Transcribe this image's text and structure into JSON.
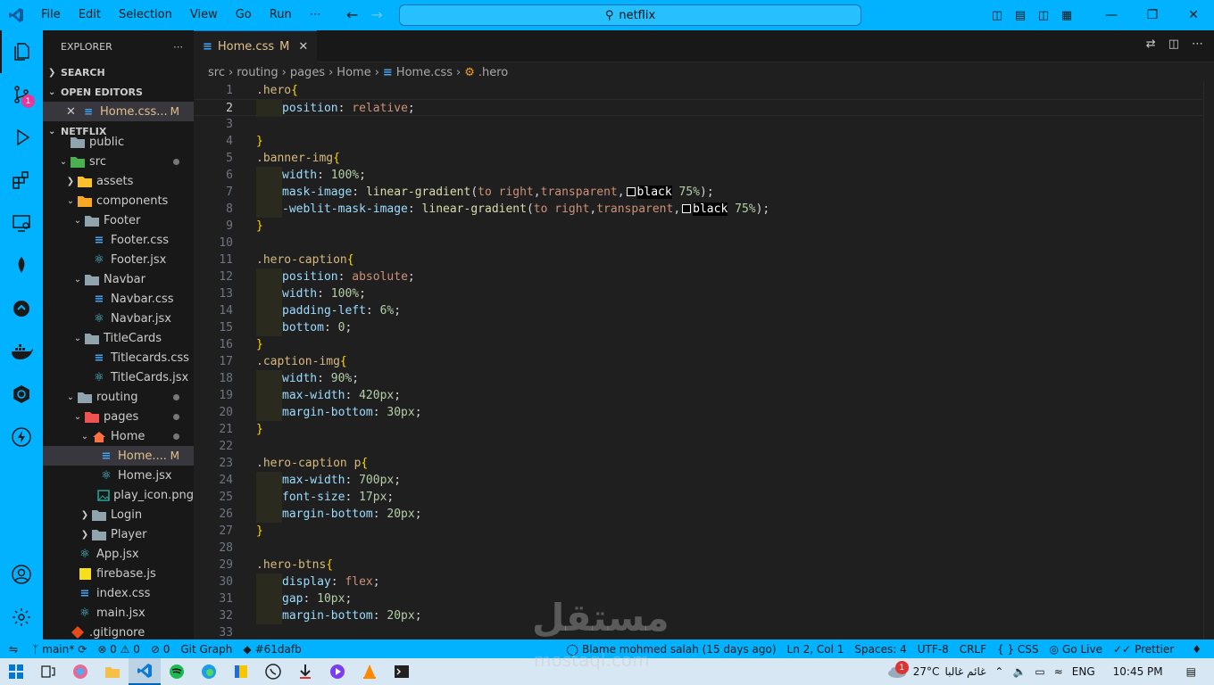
{
  "titlebar": {
    "menu": [
      "File",
      "Edit",
      "Selection",
      "View",
      "Go",
      "Run",
      "⋯"
    ],
    "search": "netflix"
  },
  "activity_badge": "1",
  "sidebar": {
    "title": "EXPLORER",
    "search": "SEARCH",
    "open_editors": "OPEN EDITORS",
    "open_file": "Home.css...",
    "open_file_mark": "M",
    "project": "NETFLIX",
    "tree": [
      {
        "label": "public",
        "depth": 1,
        "icon": "folder",
        "chev": "",
        "mark": ""
      },
      {
        "label": "src",
        "depth": 1,
        "icon": "folder-src",
        "chev": "v",
        "mark": "dot"
      },
      {
        "label": "assets",
        "depth": 2,
        "icon": "folder-assets",
        "chev": ">",
        "mark": ""
      },
      {
        "label": "components",
        "depth": 2,
        "icon": "folder-components",
        "chev": "v",
        "mark": ""
      },
      {
        "label": "Footer",
        "depth": 3,
        "icon": "folder",
        "chev": "v",
        "mark": ""
      },
      {
        "label": "Footer.css",
        "depth": 4,
        "icon": "css",
        "chev": "",
        "mark": ""
      },
      {
        "label": "Footer.jsx",
        "depth": 4,
        "icon": "react",
        "chev": "",
        "mark": ""
      },
      {
        "label": "Navbar",
        "depth": 3,
        "icon": "folder",
        "chev": "v",
        "mark": ""
      },
      {
        "label": "Navbar.css",
        "depth": 4,
        "icon": "css",
        "chev": "",
        "mark": ""
      },
      {
        "label": "Navbar.jsx",
        "depth": 4,
        "icon": "react",
        "chev": "",
        "mark": ""
      },
      {
        "label": "TitleCards",
        "depth": 3,
        "icon": "folder",
        "chev": "v",
        "mark": ""
      },
      {
        "label": "Titlecards.css",
        "depth": 4,
        "icon": "css",
        "chev": "",
        "mark": ""
      },
      {
        "label": "TitleCards.jsx",
        "depth": 4,
        "icon": "react",
        "chev": "",
        "mark": ""
      },
      {
        "label": "routing",
        "depth": 2,
        "icon": "folder",
        "chev": "v",
        "mark": "dot"
      },
      {
        "label": "pages",
        "depth": 3,
        "icon": "folder-pages",
        "chev": "v",
        "mark": "dot"
      },
      {
        "label": "Home",
        "depth": 4,
        "icon": "folder-home",
        "chev": "v",
        "mark": "dot"
      },
      {
        "label": "Home....",
        "depth": 5,
        "icon": "css",
        "chev": "",
        "mark": "M",
        "selected": true
      },
      {
        "label": "Home.jsx",
        "depth": 5,
        "icon": "react",
        "chev": "",
        "mark": ""
      },
      {
        "label": "play_icon.png",
        "depth": 5,
        "icon": "image",
        "chev": "",
        "mark": ""
      },
      {
        "label": "Login",
        "depth": 4,
        "icon": "folder",
        "chev": ">",
        "mark": ""
      },
      {
        "label": "Player",
        "depth": 4,
        "icon": "folder",
        "chev": ">",
        "mark": ""
      },
      {
        "label": "App.jsx",
        "depth": 2,
        "icon": "react",
        "chev": "",
        "mark": ""
      },
      {
        "label": "firebase.js",
        "depth": 2,
        "icon": "js",
        "chev": "",
        "mark": ""
      },
      {
        "label": "index.css",
        "depth": 2,
        "icon": "css",
        "chev": "",
        "mark": ""
      },
      {
        "label": "main.jsx",
        "depth": 2,
        "icon": "react",
        "chev": "",
        "mark": ""
      },
      {
        "label": ".gitignore",
        "depth": 1,
        "icon": "git",
        "chev": "",
        "mark": ""
      }
    ]
  },
  "tab": {
    "label": "Home.css",
    "mark": "M"
  },
  "breadcrumb": [
    "src",
    "routing",
    "pages",
    "Home",
    "Home.css",
    ".hero"
  ],
  "code": [
    [
      [
        "sel",
        ".hero"
      ],
      [
        "br",
        "{"
      ]
    ],
    [
      [
        "i",
        ""
      ],
      [
        "prop",
        "position"
      ],
      [
        "pun",
        ": "
      ],
      [
        "val",
        "relative"
      ],
      [
        "pun",
        ";"
      ]
    ],
    [],
    [
      [
        "br",
        "}"
      ]
    ],
    [
      [
        "sel",
        ".banner-img"
      ],
      [
        "br",
        "{"
      ]
    ],
    [
      [
        "i",
        ""
      ],
      [
        "prop",
        "width"
      ],
      [
        "pun",
        ": "
      ],
      [
        "num",
        "100%"
      ],
      [
        "pun",
        ";"
      ]
    ],
    [
      [
        "i",
        ""
      ],
      [
        "prop",
        "mask-image"
      ],
      [
        "pun",
        ": "
      ],
      [
        "fn",
        "linear-gradient"
      ],
      [
        "pun",
        "("
      ],
      [
        "val",
        "to"
      ],
      [
        "pun",
        " "
      ],
      [
        "val",
        "right"
      ],
      [
        "pun",
        ","
      ],
      [
        "val",
        "transparent"
      ],
      [
        "pun",
        ","
      ],
      [
        "sw",
        ""
      ],
      [
        "blk",
        "black"
      ],
      [
        "pun",
        " "
      ],
      [
        "num",
        "75%"
      ],
      [
        "pun",
        ");"
      ]
    ],
    [
      [
        "i",
        ""
      ],
      [
        "prop",
        "-weblit-mask-image"
      ],
      [
        "pun",
        ": "
      ],
      [
        "fn",
        "linear-gradient"
      ],
      [
        "pun",
        "("
      ],
      [
        "val",
        "to"
      ],
      [
        "pun",
        " "
      ],
      [
        "val",
        "right"
      ],
      [
        "pun",
        ","
      ],
      [
        "val",
        "transparent"
      ],
      [
        "pun",
        ","
      ],
      [
        "sw",
        ""
      ],
      [
        "blk",
        "black"
      ],
      [
        "pun",
        " "
      ],
      [
        "num",
        "75%"
      ],
      [
        "pun",
        ");"
      ]
    ],
    [
      [
        "br",
        "}"
      ]
    ],
    [],
    [
      [
        "sel",
        ".hero-caption"
      ],
      [
        "br",
        "{"
      ]
    ],
    [
      [
        "i",
        ""
      ],
      [
        "prop",
        "position"
      ],
      [
        "pun",
        ": "
      ],
      [
        "val",
        "absolute"
      ],
      [
        "pun",
        ";"
      ]
    ],
    [
      [
        "i",
        ""
      ],
      [
        "prop",
        "width"
      ],
      [
        "pun",
        ": "
      ],
      [
        "num",
        "100%"
      ],
      [
        "pun",
        ";"
      ]
    ],
    [
      [
        "i",
        ""
      ],
      [
        "prop",
        "padding-left"
      ],
      [
        "pun",
        ": "
      ],
      [
        "num",
        "6%"
      ],
      [
        "pun",
        ";"
      ]
    ],
    [
      [
        "i",
        ""
      ],
      [
        "prop",
        "bottom"
      ],
      [
        "pun",
        ": "
      ],
      [
        "num",
        "0"
      ],
      [
        "pun",
        ";"
      ]
    ],
    [
      [
        "br",
        "}"
      ]
    ],
    [
      [
        "sel",
        ".caption-img"
      ],
      [
        "br",
        "{"
      ]
    ],
    [
      [
        "i",
        ""
      ],
      [
        "prop",
        "width"
      ],
      [
        "pun",
        ": "
      ],
      [
        "num",
        "90%"
      ],
      [
        "pun",
        ";"
      ]
    ],
    [
      [
        "i",
        ""
      ],
      [
        "prop",
        "max-width"
      ],
      [
        "pun",
        ": "
      ],
      [
        "num",
        "420px"
      ],
      [
        "pun",
        ";"
      ]
    ],
    [
      [
        "i",
        ""
      ],
      [
        "prop",
        "margin-bottom"
      ],
      [
        "pun",
        ": "
      ],
      [
        "num",
        "30px"
      ],
      [
        "pun",
        ";"
      ]
    ],
    [
      [
        "br",
        "}"
      ]
    ],
    [],
    [
      [
        "sel",
        ".hero-caption p"
      ],
      [
        "br",
        "{"
      ]
    ],
    [
      [
        "i",
        ""
      ],
      [
        "prop",
        "max-width"
      ],
      [
        "pun",
        ": "
      ],
      [
        "num",
        "700px"
      ],
      [
        "pun",
        ";"
      ]
    ],
    [
      [
        "i",
        ""
      ],
      [
        "prop",
        "font-size"
      ],
      [
        "pun",
        ": "
      ],
      [
        "num",
        "17px"
      ],
      [
        "pun",
        ";"
      ]
    ],
    [
      [
        "i",
        ""
      ],
      [
        "prop",
        "margin-bottom"
      ],
      [
        "pun",
        ": "
      ],
      [
        "num",
        "20px"
      ],
      [
        "pun",
        ";"
      ]
    ],
    [
      [
        "br",
        "}"
      ]
    ],
    [],
    [
      [
        "sel",
        ".hero-btns"
      ],
      [
        "br",
        "{"
      ]
    ],
    [
      [
        "i",
        ""
      ],
      [
        "prop",
        "display"
      ],
      [
        "pun",
        ": "
      ],
      [
        "val",
        "flex"
      ],
      [
        "pun",
        ";"
      ]
    ],
    [
      [
        "i",
        ""
      ],
      [
        "prop",
        "gap"
      ],
      [
        "pun",
        ": "
      ],
      [
        "num",
        "10px"
      ],
      [
        "pun",
        ";"
      ]
    ],
    [
      [
        "i",
        ""
      ],
      [
        "prop",
        "margin-bottom"
      ],
      [
        "pun",
        ": "
      ],
      [
        "num",
        "20px"
      ],
      [
        "pun",
        ";"
      ]
    ],
    []
  ],
  "current_line": 2,
  "status": {
    "branch": "main*",
    "problems": "⊗ 0 ⚠ 0",
    "ports": "⊘ 0",
    "gitgraph": "Git Graph",
    "commit": "#61dafb",
    "blame": "Blame mohmed salah (15 days ago)",
    "cursor": "Ln 2, Col 1",
    "spaces": "Spaces: 4",
    "encoding": "UTF-8",
    "eol": "CRLF",
    "lang": "{ } CSS",
    "golive": "Go Live",
    "prettier": "Prettier"
  },
  "taskbar": {
    "temp": "27°C",
    "weather": "غائم غالبا",
    "lang": "ENG",
    "time": "10:45 PM",
    "weather_badge": "1"
  },
  "watermark": {
    "ar": "مستقل",
    "en": "mostaql.com"
  }
}
